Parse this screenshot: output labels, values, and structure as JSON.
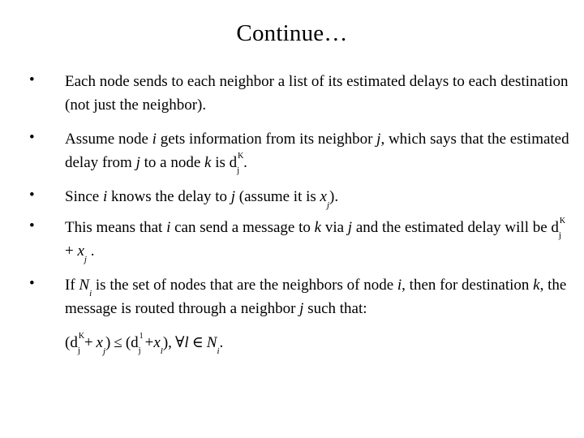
{
  "slide": {
    "title": "Continue…",
    "bullet_marker": "•",
    "bullets": [
      {
        "id": "bullet-each-node-sends",
        "segments": [
          {
            "text": "Each node sends to each neighbor a list of its estimated delays to each destination (not just the neighbor).",
            "style": "normal"
          }
        ],
        "plain": "Each node sends to each neighbor a list of its estimated delays to each destination (not just the neighbor)."
      },
      {
        "id": "bullet-assume-node-i",
        "segments": [
          {
            "text": "Assume node ",
            "style": "normal"
          },
          {
            "text": "i",
            "style": "italic"
          },
          {
            "text": " gets information from its neighbor ",
            "style": "normal"
          },
          {
            "text": "j",
            "style": "italic"
          },
          {
            "text": ", which says that the estimated delay from ",
            "style": "normal"
          },
          {
            "text": "j",
            "style": "italic"
          },
          {
            "text": " to a node ",
            "style": "normal"
          },
          {
            "text": "k",
            "style": "italic"
          },
          {
            "text": " is d",
            "style": "normal"
          },
          {
            "text": "K",
            "style": "superscript"
          },
          {
            "text": "j",
            "style": "subscript"
          },
          {
            "text": ".",
            "style": "normal"
          }
        ],
        "plain": "Assume node i gets information from its neighbor j, which says that the estimated delay from j to a node k is d K j ."
      },
      {
        "id": "bullet-since-i-knows",
        "segments": [
          {
            "text": "Since ",
            "style": "normal"
          },
          {
            "text": "i",
            "style": "italic"
          },
          {
            "text": " knows the delay to ",
            "style": "normal"
          },
          {
            "text": "j",
            "style": "italic"
          },
          {
            "text": " (assume it is ",
            "style": "normal"
          },
          {
            "text": "x",
            "style": "italic"
          },
          {
            "text": "j",
            "style": "subscript"
          },
          {
            "text": ").",
            "style": "normal"
          }
        ],
        "plain": "Since i knows the delay to j (assume it is xj)."
      },
      {
        "id": "bullet-this-means-that-i",
        "segments": [
          {
            "text": "This means that ",
            "style": "normal"
          },
          {
            "text": "i",
            "style": "italic"
          },
          {
            "text": " can send a message to ",
            "style": "normal"
          },
          {
            "text": "k",
            "style": "italic"
          },
          {
            "text": " via ",
            "style": "normal"
          },
          {
            "text": "j",
            "style": "italic"
          },
          {
            "text": " and the estimated delay will be d",
            "style": "normal"
          },
          {
            "text": "K",
            "style": "superscript"
          },
          {
            "text": "j",
            "style": "subscript"
          },
          {
            "text": " + ",
            "style": "normal"
          },
          {
            "text": "x",
            "style": "italic"
          },
          {
            "text": "j",
            "style": "subscript"
          },
          {
            "text": " .",
            "style": "normal"
          }
        ],
        "plain": "This means that i can send a message to k via j and the estimated delay will be d K j + xj ."
      },
      {
        "id": "bullet-if-ni-is-set",
        "segments": [
          {
            "text": "If ",
            "style": "normal"
          },
          {
            "text": "N",
            "style": "italic"
          },
          {
            "text": "i",
            "style": "subscript"
          },
          {
            "text": " is the set of nodes that are the neighbors of node ",
            "style": "normal"
          },
          {
            "text": "i",
            "style": "italic"
          },
          {
            "text": ", then for destination ",
            "style": "normal"
          },
          {
            "text": "k",
            "style": "italic"
          },
          {
            "text": ", the message is routed through a neighbor ",
            "style": "normal"
          },
          {
            "text": "j",
            "style": "italic"
          },
          {
            "text": " such that:",
            "style": "normal"
          }
        ],
        "plain": "If Ni is the set of nodes that are the neighbors of node i, then for destination k, the message is routed through a neighbor j such that:"
      }
    ],
    "formula": {
      "id": "routing-inequality",
      "plain": "(d K j + xj) ≤ (d 1 j + xl), ∀l ∈ Ni.",
      "parts": {
        "open_paren": "(",
        "d_base": "d",
        "d_sup_1": "K",
        "d_sub_1": "j",
        "plus_1": "+",
        "x_1": "x",
        "x_1_sub": "j",
        "close_paren_1": ")",
        "relation": "≤",
        "open_paren_2": "(",
        "d_base_2": "d",
        "d_sup_2": "1",
        "d_sub_2": "j",
        "plus_2": "+",
        "x_2": "x",
        "x_2_sub": "l",
        "close_paren_2": "),",
        "forall": "∀",
        "l_var": "l",
        "element_of": "∈",
        "n_var": "N",
        "n_sub": "i",
        "period": "."
      }
    },
    "colors": {
      "background": "#ffffff",
      "text": "#000000"
    }
  }
}
